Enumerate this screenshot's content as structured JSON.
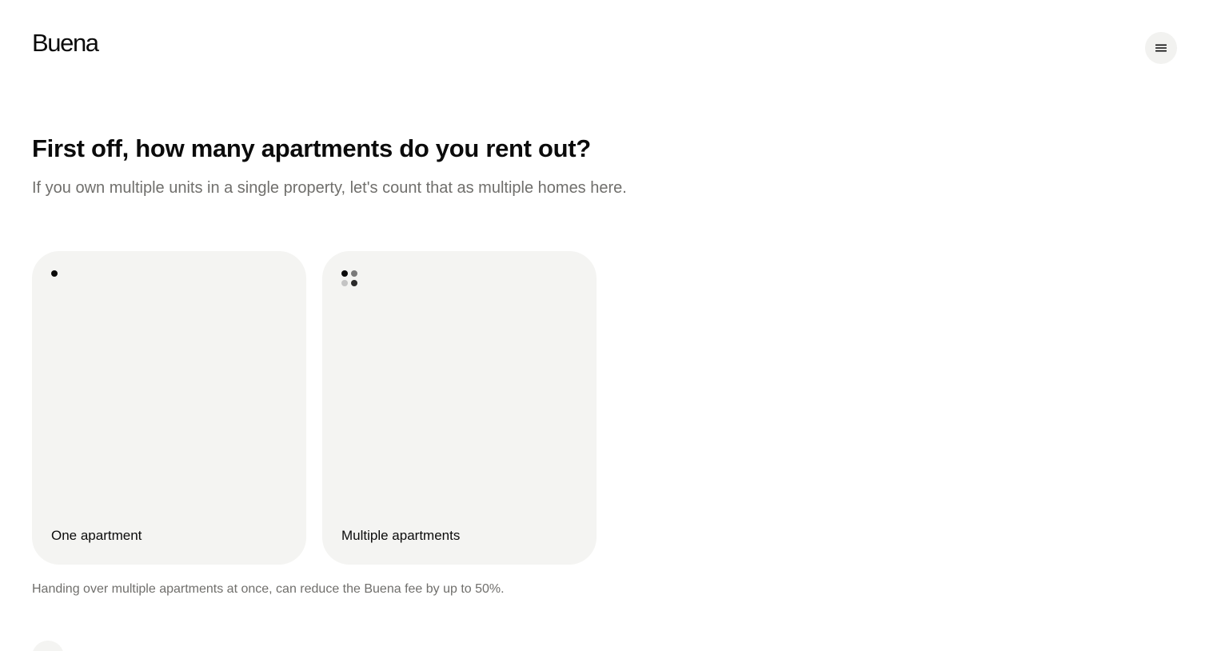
{
  "header": {
    "logo_text": "Buena",
    "menu_icon": "hamburger-menu-icon"
  },
  "question": {
    "title": "First off, how many apartments do you rent out?",
    "subtitle": "If you own multiple units in a single property, let's count that as multiple homes here."
  },
  "options": [
    {
      "label": "One apartment",
      "icon": "single-dot-icon"
    },
    {
      "label": "Multiple apartments",
      "icon": "four-dots-icon"
    }
  ],
  "note": "Handing over multiple apartments at once, can reduce the Buena fee by up to 50%.",
  "colors": {
    "background": "#ffffff",
    "text": "#0b0b0b",
    "muted_text": "#706f6c",
    "card_background": "#f4f4f2"
  }
}
